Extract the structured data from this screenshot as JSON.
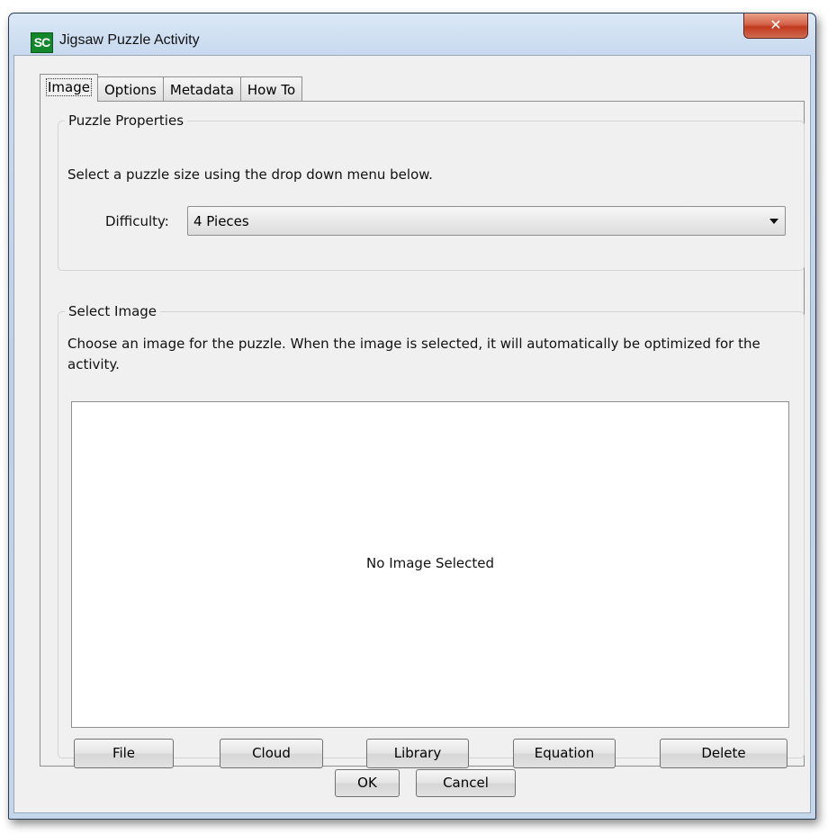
{
  "window": {
    "title": "Jigsaw Puzzle Activity",
    "app_icon_text": "SC",
    "close_symbol": "✕"
  },
  "tabs": [
    {
      "label": "Image",
      "active": true
    },
    {
      "label": "Options",
      "active": false
    },
    {
      "label": "Metadata",
      "active": false
    },
    {
      "label": "How To",
      "active": false
    }
  ],
  "puzzle_properties": {
    "legend": "Puzzle Properties",
    "description": "Select a puzzle size using the drop down menu below.",
    "difficulty_label": "Difficulty:",
    "difficulty_value": "4 Pieces"
  },
  "select_image": {
    "legend": "Select Image",
    "description": "Choose an image for the puzzle. When the image is selected, it will automatically be optimized for the activity.",
    "placeholder": "No Image Selected",
    "buttons": [
      "File",
      "Cloud",
      "Library",
      "Equation",
      "Delete"
    ]
  },
  "footer": {
    "ok_label": "OK",
    "cancel_label": "Cancel"
  },
  "colors": {
    "close_button": "#c13a1f",
    "app_icon": "#13872b"
  }
}
